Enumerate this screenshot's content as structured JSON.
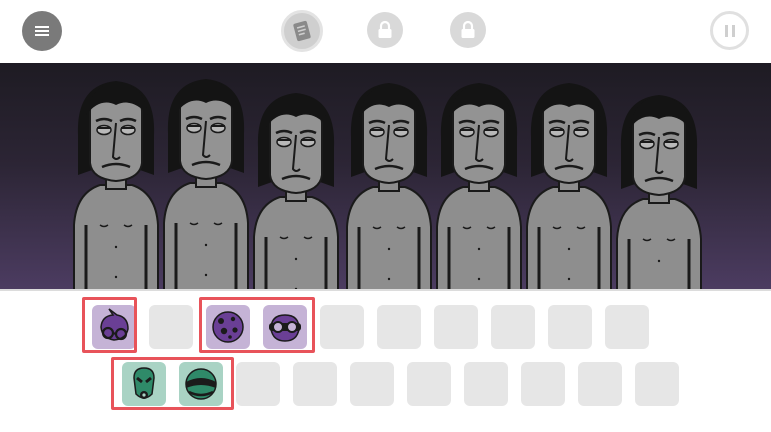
{
  "toolbar": {
    "menu_icon": "hamburger-menu-icon",
    "notes_icon": "notes-icon",
    "lock_icons": [
      "lock-icon",
      "lock-icon"
    ],
    "pause_icon": "pause-icon"
  },
  "stage": {
    "character_count": 7,
    "background_colors": [
      "#1e1b23",
      "#4c3c61"
    ]
  },
  "tray": {
    "row1": [
      {
        "state": "filled",
        "icon": "purple-glasses-sound-icon",
        "highlighted": true
      },
      {
        "state": "empty"
      },
      {
        "state": "filled",
        "icon": "purple-spotted-sound-icon",
        "highlighted": true
      },
      {
        "state": "filled",
        "icon": "purple-goggles-sound-icon",
        "highlighted": true
      },
      {
        "state": "empty"
      },
      {
        "state": "empty"
      },
      {
        "state": "empty"
      },
      {
        "state": "empty"
      },
      {
        "state": "empty"
      },
      {
        "state": "empty"
      }
    ],
    "row2": [
      {
        "state": "filled",
        "icon": "green-alien-sound-icon",
        "highlighted": true
      },
      {
        "state": "filled",
        "icon": "green-helmet-sound-icon",
        "highlighted": true
      },
      {
        "state": "empty"
      },
      {
        "state": "empty"
      },
      {
        "state": "empty"
      },
      {
        "state": "empty"
      },
      {
        "state": "empty"
      },
      {
        "state": "empty"
      },
      {
        "state": "empty"
      },
      {
        "state": "empty"
      }
    ],
    "highlight_color": "#e8535a",
    "purple": "#6a3f95",
    "green": "#2f8a69"
  }
}
